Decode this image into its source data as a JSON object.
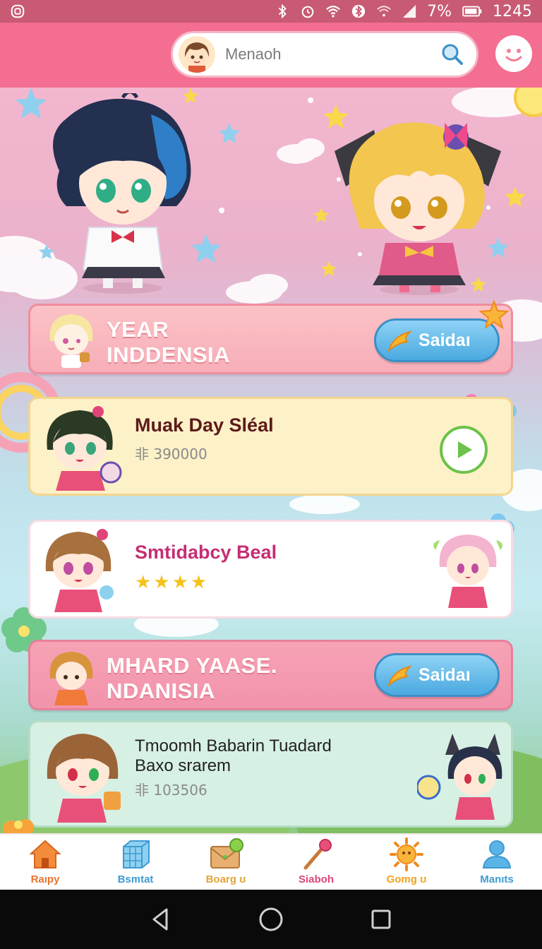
{
  "status_bar": {
    "battery": "7%",
    "time": "1245"
  },
  "search": {
    "placeholder": "Menaoh"
  },
  "banners": [
    {
      "title": "YEAR\nINDDENSIA",
      "button_label": "Saidaı"
    },
    {
      "title": "MHARD YAASE.\nNDANISIA",
      "button_label": "Saidaı"
    }
  ],
  "cards": [
    {
      "title": "Muak Day Sléal",
      "subtitle": "⾮ 390000"
    },
    {
      "title": "Smtidabcy Beal",
      "rating": "★★★★"
    },
    {
      "title": "Tmoomh Babarin Tuadard\nBaxo srarem",
      "subtitle": "⾮ 103506"
    }
  ],
  "bottom_nav": [
    {
      "label": "Raıpy",
      "color": "#e8732f",
      "icon": "home-icon"
    },
    {
      "label": "Bsmtat",
      "color": "#3d9bd3",
      "icon": "cube-icon"
    },
    {
      "label": "Boarg ʊ",
      "color": "#e2a43a",
      "icon": "mail-icon"
    },
    {
      "label": "Siaboh",
      "color": "#e0457a",
      "icon": "wand-icon"
    },
    {
      "label": "Gomg ʊ",
      "color": "#f2a31b",
      "icon": "sun-icon"
    },
    {
      "label": "Manıts",
      "color": "#3d9bd3",
      "icon": "person-icon"
    }
  ],
  "colors": {
    "header": "#f36e91",
    "accent_blue": "#4aa9df",
    "play_green": "#6cc24a"
  }
}
